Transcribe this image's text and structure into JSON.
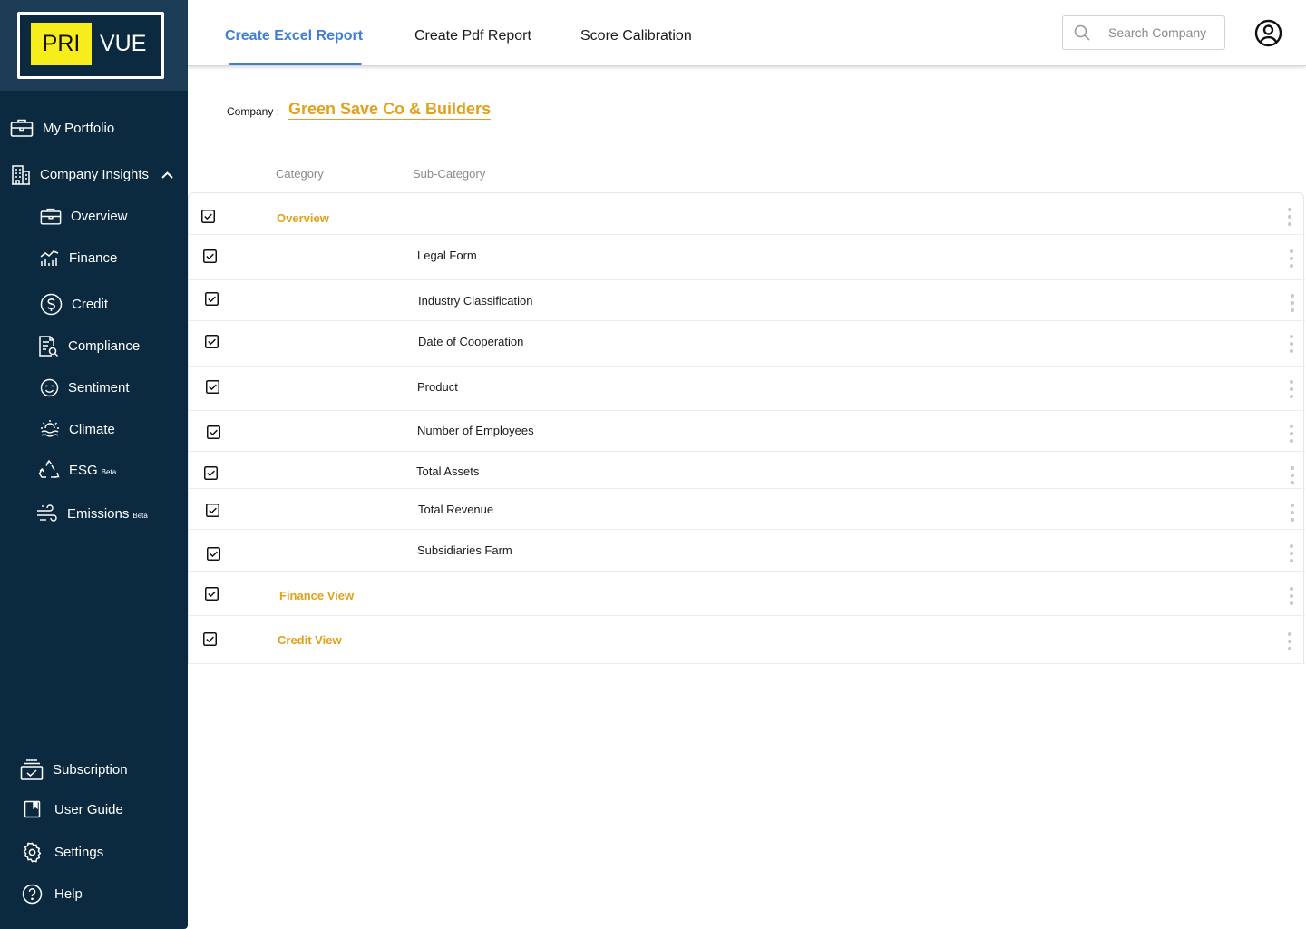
{
  "brand": {
    "logo_left": "PRI",
    "logo_right": "VUE",
    "logo_highlight": "#f7ec1c",
    "accent": "#e0a11b",
    "link_blue": "#3f7fd3",
    "sidebar_bg": "#0b2a40"
  },
  "sidebar": {
    "portfolio": {
      "label": "My Portfolio",
      "icon": "briefcase-icon"
    },
    "insights": {
      "label": "Company Insights",
      "icon": "building-icon",
      "expanded": true
    },
    "sub_items": [
      {
        "label": "Overview",
        "icon": "briefcase-icon"
      },
      {
        "label": "Finance",
        "icon": "finance-chart-icon"
      },
      {
        "label": "Credit",
        "icon": "dollar-icon"
      },
      {
        "label": "Compliance",
        "icon": "document-search-icon"
      },
      {
        "label": "Sentiment",
        "icon": "smiley-icon"
      },
      {
        "label": "Climate",
        "icon": "climate-icon"
      },
      {
        "label": "ESG",
        "badge": "Beta",
        "icon": "recycle-icon"
      },
      {
        "label": "Emissions",
        "badge": "Beta",
        "icon": "wind-icon"
      }
    ],
    "bottom_items": [
      {
        "label": "Subscription",
        "icon": "subscription-icon"
      },
      {
        "label": "User Guide",
        "icon": "book-icon"
      },
      {
        "label": "Settings",
        "icon": "gear-icon"
      },
      {
        "label": "Help",
        "icon": "help-icon"
      }
    ]
  },
  "header": {
    "tabs": [
      {
        "label": "Create Excel Report",
        "active": true
      },
      {
        "label": "Create Pdf Report",
        "active": false
      },
      {
        "label": "Score Calibration",
        "active": false
      }
    ],
    "search_placeholder": "Search Company"
  },
  "company": {
    "label": "Company :",
    "name": "Green Save Co & Builders"
  },
  "table": {
    "columns": [
      "Category",
      "Sub-Category"
    ],
    "rows": [
      {
        "category": "Overview",
        "subcategory": "",
        "checked": true
      },
      {
        "category": "",
        "subcategory": "Legal Form",
        "checked": true
      },
      {
        "category": "",
        "subcategory": "Industry Classification",
        "checked": true
      },
      {
        "category": "",
        "subcategory": "Date of Cooperation",
        "checked": true
      },
      {
        "category": "",
        "subcategory": "Product",
        "checked": true
      },
      {
        "category": "",
        "subcategory": "Number of Employees",
        "checked": true
      },
      {
        "category": "",
        "subcategory": "Total Assets",
        "checked": true
      },
      {
        "category": "",
        "subcategory": "Total Revenue",
        "checked": true
      },
      {
        "category": "",
        "subcategory": "Subsidiaries Farm",
        "checked": true
      },
      {
        "category": "Finance View",
        "subcategory": "",
        "checked": true
      },
      {
        "category": "Credit View",
        "subcategory": "",
        "checked": true
      }
    ]
  }
}
